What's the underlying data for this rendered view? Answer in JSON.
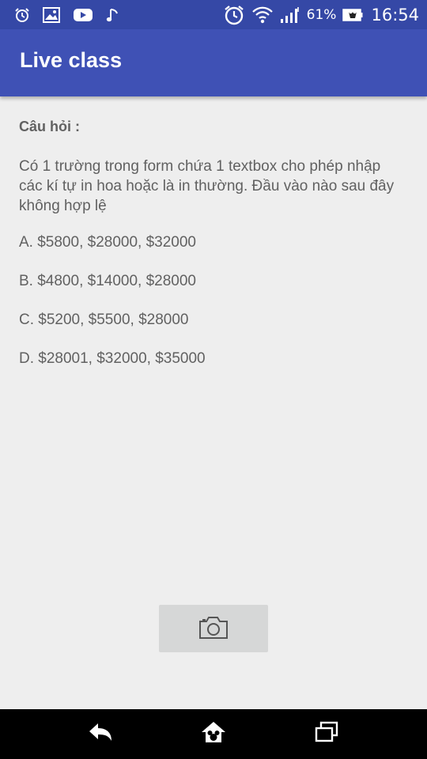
{
  "status_bar": {
    "left_icons": [
      "alarm-icon",
      "image-icon",
      "youtube-icon",
      "music-note-icon"
    ],
    "right_icons": [
      "alarm-clock-icon",
      "wifi-icon",
      "signal-icon"
    ],
    "battery_percent": "61%",
    "time": "16:54"
  },
  "app_bar": {
    "title": "Live class"
  },
  "question": {
    "heading": "Câu hỏi :",
    "text": "Có 1 trường trong form chứa 1 textbox cho phép nhập các kí tự in hoa hoặc là in thường. Đầu vào nào sau đây không hợp lệ",
    "options": [
      "A. $5800, $28000, $32000",
      "B. $4800, $14000, $28000",
      "C. $5200, $5500, $28000",
      "D. $28001, $32000, $35000"
    ]
  },
  "camera_button": {
    "icon": "camera-icon"
  },
  "nav_bar": {
    "buttons": [
      "back-icon",
      "home-icon",
      "recents-icon"
    ]
  },
  "colors": {
    "status_bar": "#3548a6",
    "app_bar": "#3f51b5",
    "background": "#eeeeee",
    "text": "#616161",
    "camera_button": "#d6d7d7",
    "nav_bar": "#000000"
  }
}
